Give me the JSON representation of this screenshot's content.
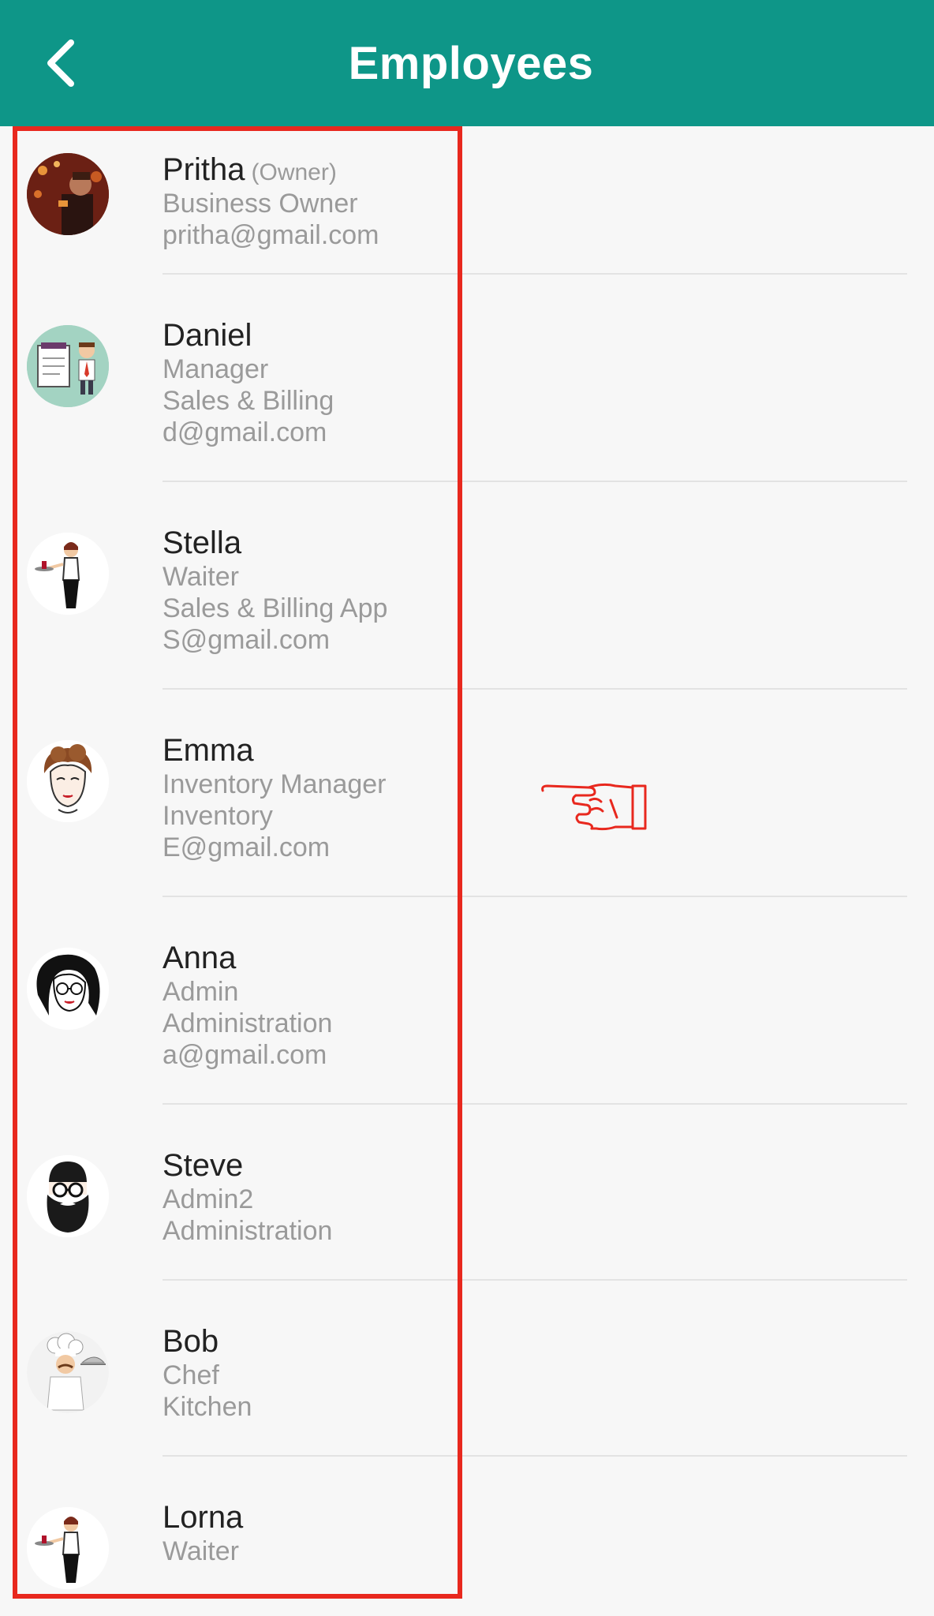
{
  "header": {
    "title": "Employees",
    "back_icon": "chevron-left-icon",
    "background_color": "#0e9688"
  },
  "employees": [
    {
      "name": "Pritha",
      "tag": "(Owner)",
      "lines": [
        "Business Owner",
        "pritha@gmail.com"
      ],
      "avatar": "photo-avatar"
    },
    {
      "name": "Daniel",
      "tag": "",
      "lines": [
        "Manager",
        "Sales & Billing",
        "d@gmail.com"
      ],
      "avatar": "manager-illustration-avatar"
    },
    {
      "name": "Stella",
      "tag": "",
      "lines": [
        "Waiter",
        "Sales & Billing App",
        "S@gmail.com"
      ],
      "avatar": "waiter-illustration-avatar"
    },
    {
      "name": "Emma",
      "tag": "",
      "lines": [
        "Inventory Manager",
        "Inventory",
        "E@gmail.com"
      ],
      "avatar": "woman-sketch-avatar"
    },
    {
      "name": "Anna",
      "tag": "",
      "lines": [
        "Admin",
        "Administration",
        "a@gmail.com"
      ],
      "avatar": "woman-glasses-sketch-avatar"
    },
    {
      "name": "Steve",
      "tag": "",
      "lines": [
        "Admin2",
        "Administration"
      ],
      "avatar": "bearded-man-glasses-avatar"
    },
    {
      "name": "Bob",
      "tag": "",
      "lines": [
        "Chef",
        "Kitchen"
      ],
      "avatar": "chef-illustration-avatar"
    },
    {
      "name": "Lorna",
      "tag": "",
      "lines": [
        "Waiter"
      ],
      "avatar": "waiter-illustration-avatar"
    }
  ],
  "annotations": {
    "highlight_color": "#e8281e",
    "pointer_icon": "pointing-hand-icon"
  },
  "colors": {
    "name_text": "#222222",
    "secondary_text": "#9a9a9a",
    "divider": "#e3e3e3",
    "background": "#f7f7f7"
  }
}
